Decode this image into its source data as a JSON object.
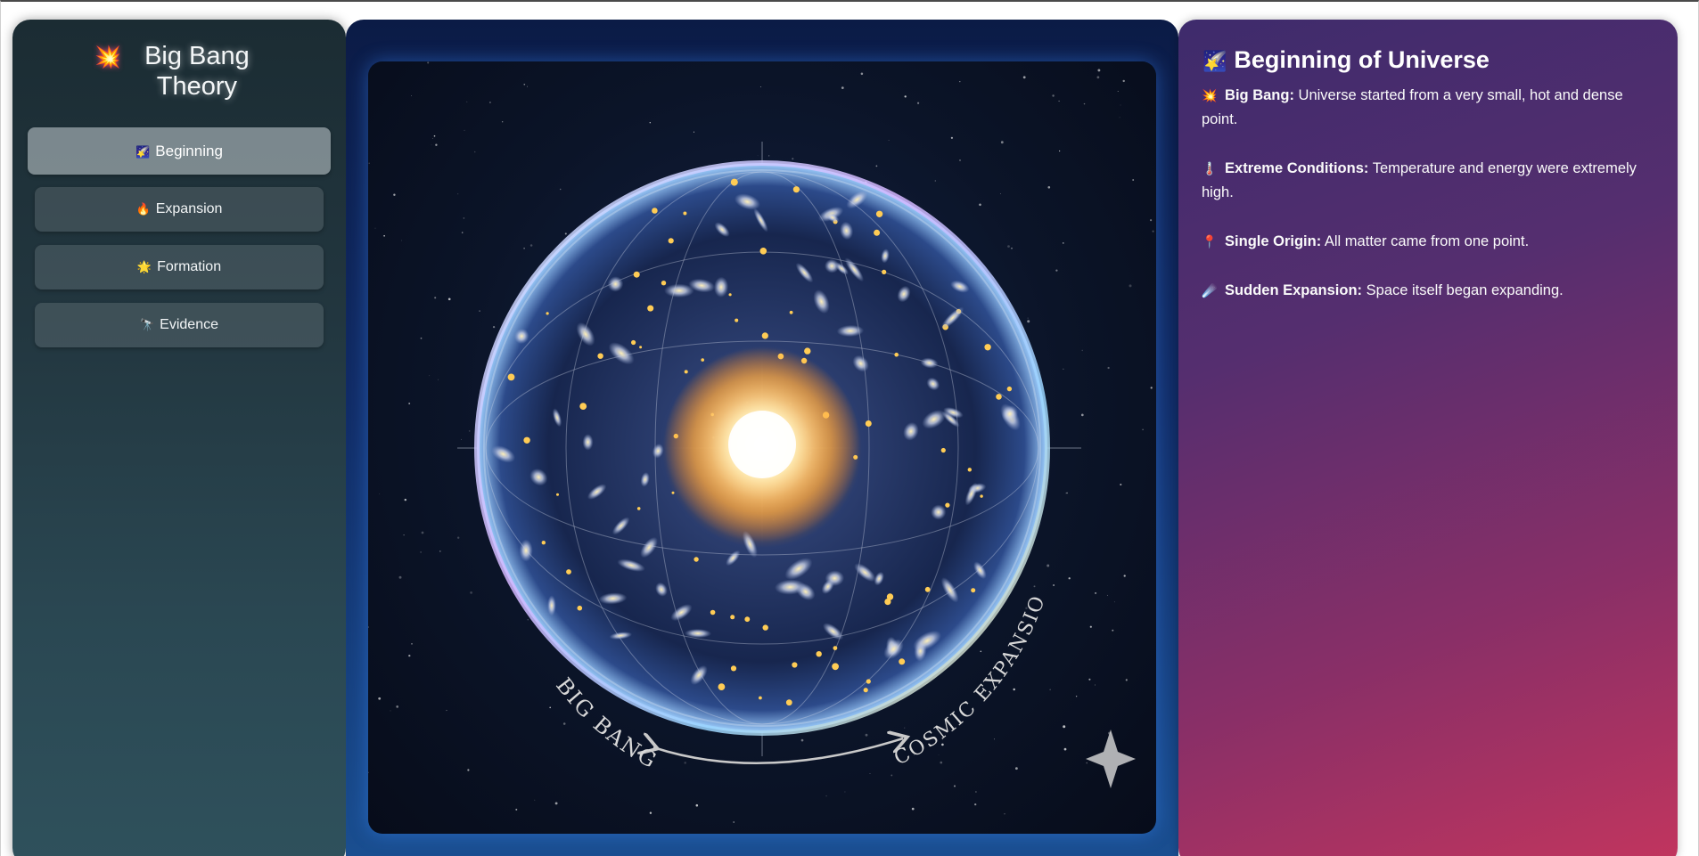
{
  "sidebar": {
    "title_icon": "💥",
    "title": "Big Bang Theory",
    "items": [
      {
        "icon": "🌠",
        "label": "Beginning",
        "active": true
      },
      {
        "icon": "🔥",
        "label": "Expansion",
        "active": false
      },
      {
        "icon": "🌟",
        "label": "Formation",
        "active": false
      },
      {
        "icon": "🔭",
        "label": "Evidence",
        "active": false
      }
    ]
  },
  "image": {
    "label_left": "BIG BANG",
    "label_right": "COSMIC EXPANSION"
  },
  "info": {
    "title_icon": "🌠",
    "title": "Beginning of Universe",
    "facts": [
      {
        "icon": "💥",
        "heading": "Big Bang:",
        "text": "Universe started from a very small, hot and dense point."
      },
      {
        "icon": "🌡️",
        "heading": "Extreme Conditions:",
        "text": "Temperature and energy were extremely high."
      },
      {
        "icon": "📍",
        "heading": "Single Origin:",
        "text": "All matter came from one point."
      },
      {
        "icon": "☄️",
        "heading": "Sudden Expansion:",
        "text": "Space itself began expanding."
      }
    ]
  },
  "colors": {
    "sidebar_bg": "#22363f",
    "nav_active": "#c8d2d6",
    "center_bg": "#112c66",
    "info_gradient_start": "#3e2b6c",
    "info_gradient_end": "#c2355e"
  }
}
